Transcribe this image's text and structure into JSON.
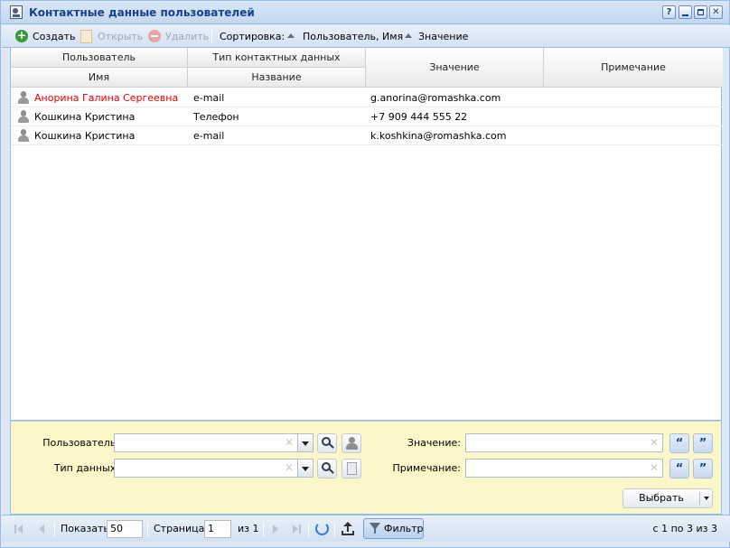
{
  "window": {
    "title": "Контактные данные пользователей"
  },
  "toolbar": {
    "create_label": "Создать",
    "open_label": "Открыть",
    "delete_label": "Удалить",
    "sort_label": "Сортировка:",
    "sort_items": [
      "Пользователь, Имя",
      "Значение"
    ]
  },
  "grid": {
    "group_headers": {
      "user": "Пользователь",
      "contact_type": "Тип контактных данных"
    },
    "columns": {
      "name": "Имя",
      "title": "Название",
      "value": "Значение",
      "note": "Примечание"
    },
    "rows": [
      {
        "name": "Анорина Галина Сергеевна",
        "type": "e-mail",
        "value": "g.anorina@romashka.com",
        "note": ""
      },
      {
        "name": "Кошкина Кристина",
        "type": "Телефон",
        "value": "+7 909 444 555 22",
        "note": ""
      },
      {
        "name": "Кошкина Кристина",
        "type": "e-mail",
        "value": "k.koshkina@romashka.com",
        "note": ""
      }
    ]
  },
  "filter": {
    "user_label": "Пользователь:",
    "type_label": "Тип данных:",
    "value_label": "Значение:",
    "note_label": "Примечание:",
    "quote_open": "“",
    "quote_close": "”",
    "select_label": "Выбрать"
  },
  "paging": {
    "show_label": "Показать",
    "page_size": "50",
    "page_label": "Страница",
    "page_value": "1",
    "of_label": "из 1",
    "filter_label": "Фильтр",
    "summary": "с 1 по 3 из 3"
  },
  "colors": {
    "header_text": "#15428b",
    "highlight_name": "#e00000",
    "filter_bg": "#fbf7c9"
  }
}
